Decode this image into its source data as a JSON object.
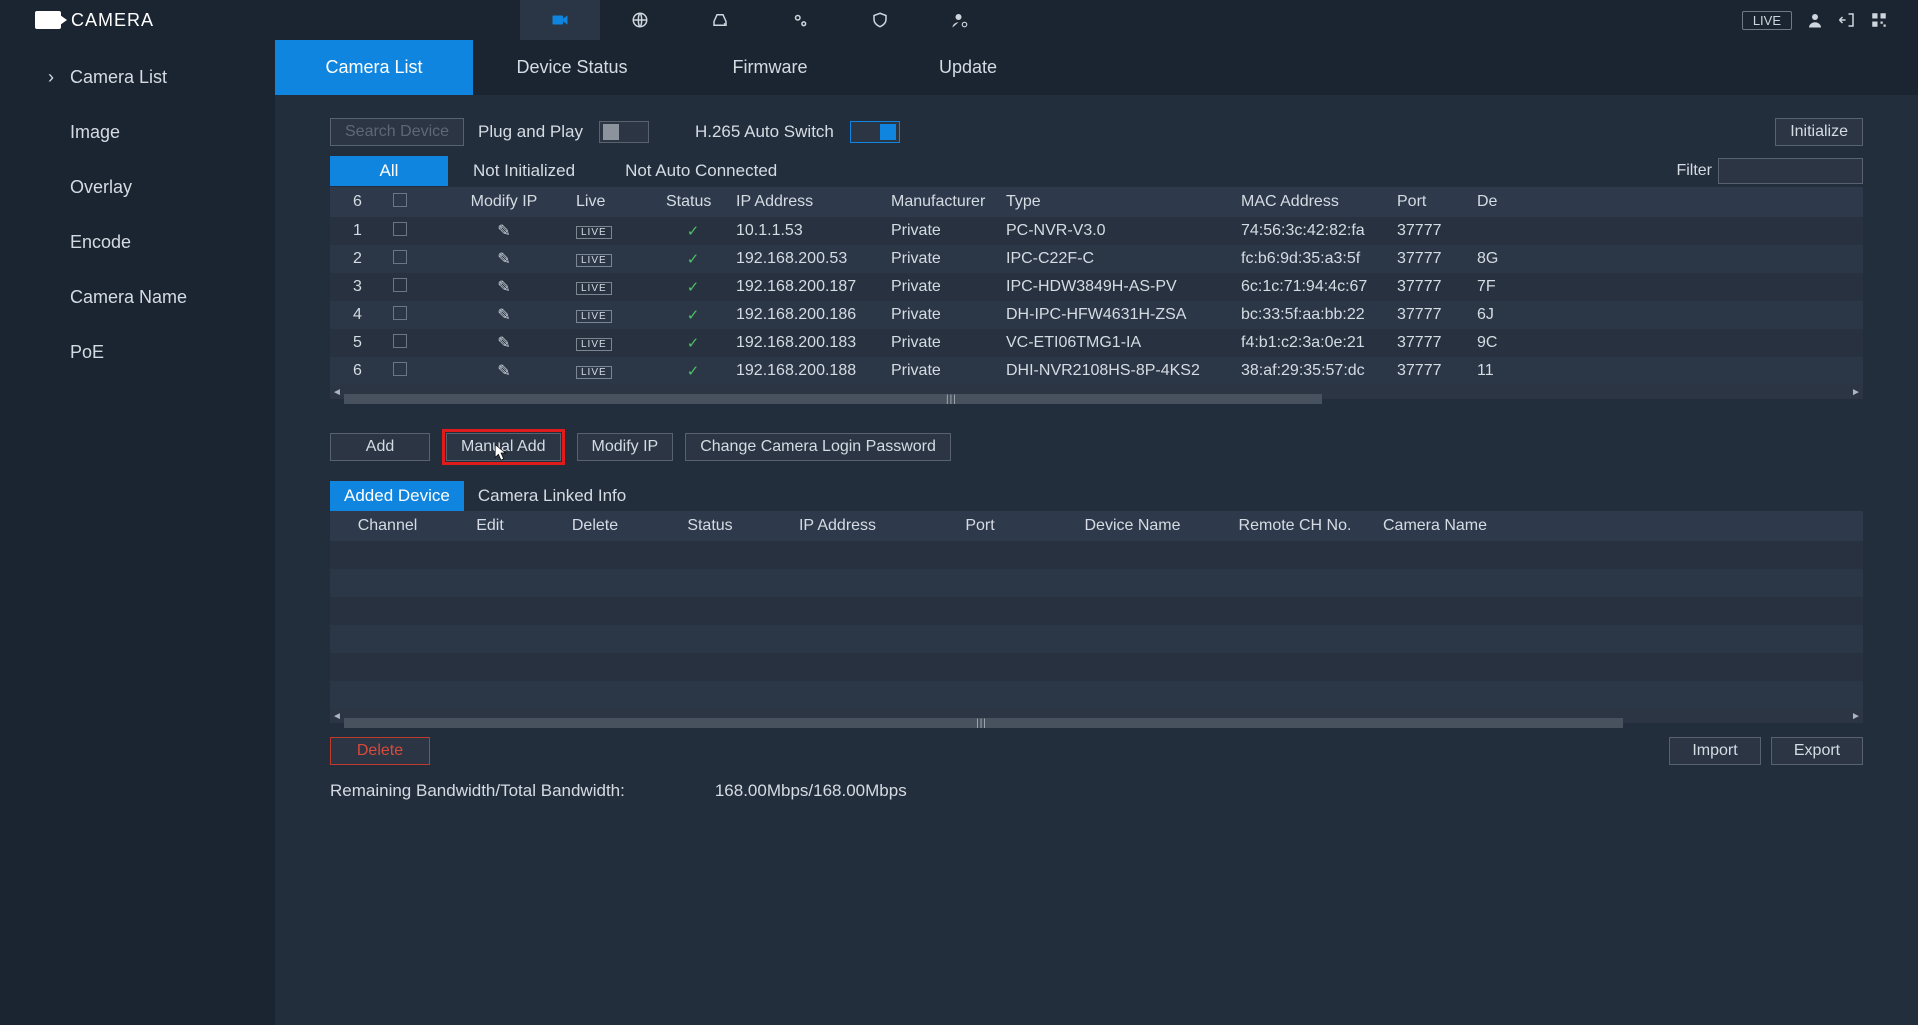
{
  "topbar": {
    "title": "CAMERA",
    "live_label": "LIVE"
  },
  "sidebar": {
    "items": [
      {
        "label": "Camera List"
      },
      {
        "label": "Image"
      },
      {
        "label": "Overlay"
      },
      {
        "label": "Encode"
      },
      {
        "label": "Camera Name"
      },
      {
        "label": "PoE"
      }
    ]
  },
  "subtabs": [
    {
      "label": "Camera List",
      "active": true
    },
    {
      "label": "Device Status"
    },
    {
      "label": "Firmware"
    },
    {
      "label": "Update"
    }
  ],
  "row1": {
    "search_label": "Search Device",
    "pnp_label": "Plug and Play",
    "h265_label": "H.265 Auto Switch",
    "initialize_label": "Initialize"
  },
  "filter_tabs": [
    {
      "label": "All",
      "active": true
    },
    {
      "label": "Not Initialized"
    },
    {
      "label": "Not Auto Connected"
    }
  ],
  "filter_label": "Filter",
  "device_table": {
    "count": "6",
    "headers": [
      "Modify IP",
      "Live",
      "Status",
      "IP Address",
      "Manufacturer",
      "Type",
      "MAC Address",
      "Port",
      "De"
    ],
    "rows": [
      {
        "n": "1",
        "ip": "10.1.1.53",
        "mfr": "Private",
        "type": "PC-NVR-V3.0",
        "mac": "74:56:3c:42:82:fa",
        "port": "37777",
        "extra": ""
      },
      {
        "n": "2",
        "ip": "192.168.200.53",
        "mfr": "Private",
        "type": "IPC-C22F-C",
        "mac": "fc:b6:9d:35:a3:5f",
        "port": "37777",
        "extra": "8G"
      },
      {
        "n": "3",
        "ip": "192.168.200.187",
        "mfr": "Private",
        "type": "IPC-HDW3849H-AS-PV",
        "mac": "6c:1c:71:94:4c:67",
        "port": "37777",
        "extra": "7F"
      },
      {
        "n": "4",
        "ip": "192.168.200.186",
        "mfr": "Private",
        "type": "DH-IPC-HFW4631H-ZSA",
        "mac": "bc:33:5f:aa:bb:22",
        "port": "37777",
        "extra": "6J"
      },
      {
        "n": "5",
        "ip": "192.168.200.183",
        "mfr": "Private",
        "type": "VC-ETI06TMG1-IA",
        "mac": "f4:b1:c2:3a:0e:21",
        "port": "37777",
        "extra": "9C"
      },
      {
        "n": "6",
        "ip": "192.168.200.188",
        "mfr": "Private",
        "type": "DHI-NVR2108HS-8P-4KS2",
        "mac": "38:af:29:35:57:dc",
        "port": "37777",
        "extra": "11"
      }
    ]
  },
  "action_buttons": {
    "add": "Add",
    "manual_add": "Manual Add",
    "modify_ip": "Modify IP",
    "change_pw": "Change Camera Login Password"
  },
  "added_tabs": [
    {
      "label": "Added Device",
      "active": true
    },
    {
      "label": "Camera Linked Info"
    }
  ],
  "added_table": {
    "headers": [
      "Channel",
      "Edit",
      "Delete",
      "Status",
      "IP Address",
      "Port",
      "Device Name",
      "Remote CH No.",
      "Camera Name"
    ]
  },
  "bottom_buttons": {
    "delete": "Delete",
    "import": "Import",
    "export": "Export"
  },
  "bandwidth": {
    "label": "Remaining Bandwidth/Total Bandwidth:",
    "value": "168.00Mbps/168.00Mbps"
  }
}
